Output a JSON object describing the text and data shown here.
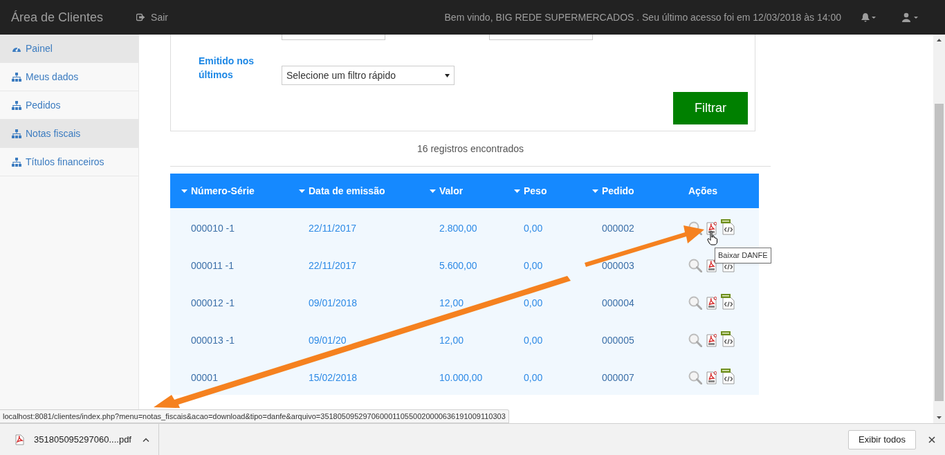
{
  "navbar": {
    "brand": "Área de Clientes",
    "logout": "Sair",
    "welcome": "Bem vindo, BIG REDE SUPERMERCADOS . Seu último acesso foi em 12/03/2018 às 14:00"
  },
  "sidebar": {
    "items": [
      {
        "label": "Painel",
        "kind": "dashboard",
        "selected": true
      },
      {
        "label": "Meus dados",
        "kind": "sitemap",
        "selected": false
      },
      {
        "label": "Pedidos",
        "kind": "sitemap",
        "selected": false
      },
      {
        "label": "Notas fiscais",
        "kind": "sitemap",
        "selected": true
      },
      {
        "label": "Títulos financeiros",
        "kind": "sitemap",
        "selected": false
      }
    ]
  },
  "filter": {
    "label": "Emitido nos últimos",
    "select_value": "Selecione um filtro rápido",
    "button": "Filtrar"
  },
  "result_count": "16 registros encontrados",
  "table": {
    "columns": [
      {
        "label": "Número-Série",
        "sortable": true
      },
      {
        "label": "Data de emissão",
        "sortable": true
      },
      {
        "label": "Valor",
        "sortable": true
      },
      {
        "label": "Peso",
        "sortable": true
      },
      {
        "label": "Pedido",
        "sortable": true
      },
      {
        "label": "Ações",
        "sortable": false
      }
    ],
    "rows": [
      {
        "cells": [
          "000010 -1",
          "22/11/2017",
          "2.800,00",
          "0,00",
          "000002"
        ]
      },
      {
        "cells": [
          "000011 -1",
          "22/11/2017",
          "5.600,00",
          "0,00",
          "000003"
        ]
      },
      {
        "cells": [
          "000012 -1",
          "09/01/2018",
          "12,00",
          "0,00",
          "000004"
        ]
      },
      {
        "cells": [
          "000013 -1",
          "09/01/20",
          "12,00",
          "0,00",
          "000005"
        ]
      },
      {
        "cells": [
          "00001",
          "15/02/2018",
          "10.000,00",
          "0,00",
          "000007"
        ]
      }
    ]
  },
  "tooltip": "Baixar DANFE",
  "status_url": "localhost:8081/clientes/index.php?menu=notas_fiscais&acao=download&tipo=danfe&arquivo=35180509529706000110550020000636191009110303",
  "download_bar": {
    "file": "351805095297060....pdf",
    "show_all": "Exibir todos"
  }
}
